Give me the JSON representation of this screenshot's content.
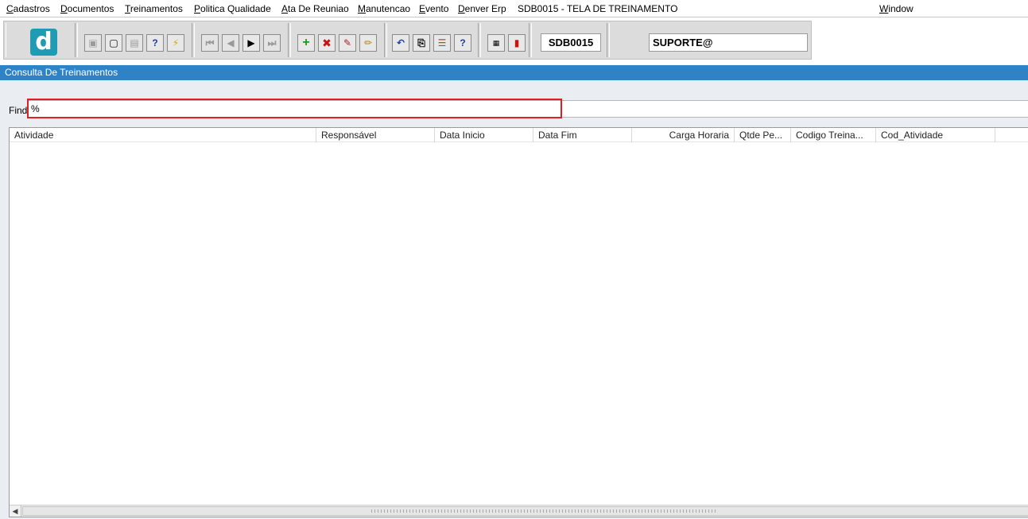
{
  "menu": {
    "items": [
      {
        "first": "C",
        "rest": "adastros"
      },
      {
        "first": "D",
        "rest": "ocumentos"
      },
      {
        "first": "T",
        "rest": "reinamentos"
      },
      {
        "first": "P",
        "rest": "olitica Qualidade"
      },
      {
        "first": "A",
        "rest": "ta De Reuniao"
      },
      {
        "first": "M",
        "rest": "anutencao"
      },
      {
        "first": "E",
        "rest": "vento"
      },
      {
        "first": "D",
        "rest": "enver Erp"
      }
    ],
    "screen_title": "SDB0015 - TELA DE TREINAMENTO",
    "window": {
      "first": "W",
      "rest": "indow"
    }
  },
  "toolbar": {
    "logo_glyph": "d",
    "screen_code": "SDB0015",
    "user": "SUPORTE@"
  },
  "window_title": "Consulta De Treinamentos",
  "find": {
    "label": "Find",
    "value": "%"
  },
  "grid": {
    "columns": [
      "Atividade",
      "Responsável",
      "Data Inicio",
      "Data Fim",
      "Carga Horaria",
      "Qtde Pe...",
      "Codigo Treina...",
      "Cod_Atividade"
    ],
    "rows": []
  }
}
